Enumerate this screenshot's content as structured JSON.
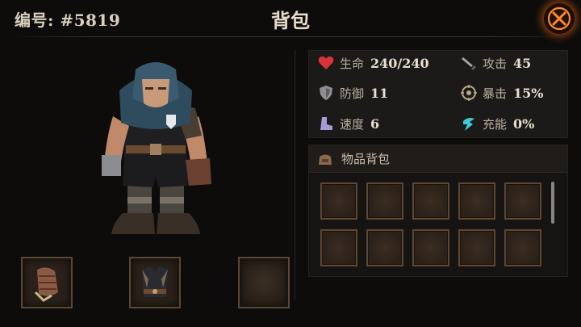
{
  "header": {
    "id_label": "编号: #5819",
    "title": "背包"
  },
  "stats": [
    {
      "icon": "heart-icon",
      "label": "生命",
      "value": "240/240"
    },
    {
      "icon": "sword-icon",
      "label": "攻击",
      "value": "45"
    },
    {
      "icon": "shield-icon",
      "label": "防御",
      "value": "11"
    },
    {
      "icon": "crit-icon",
      "label": "暴击",
      "value": "15%"
    },
    {
      "icon": "boot-icon",
      "label": "速度",
      "value": "6"
    },
    {
      "icon": "energy-icon",
      "label": "充能",
      "value": "0%"
    }
  ],
  "backpack": {
    "title": "物品背包",
    "icon": "bag-icon"
  },
  "equipment": [
    {
      "name": "glove-slot",
      "item": "leather-glove-icon"
    },
    {
      "name": "armor-slot",
      "item": "armor-vest-icon"
    },
    {
      "name": "empty-slot",
      "item": ""
    }
  ],
  "colors": {
    "accent": "#ff7a1a",
    "background": "#0d0c0b",
    "panel": "#1c1a18"
  }
}
